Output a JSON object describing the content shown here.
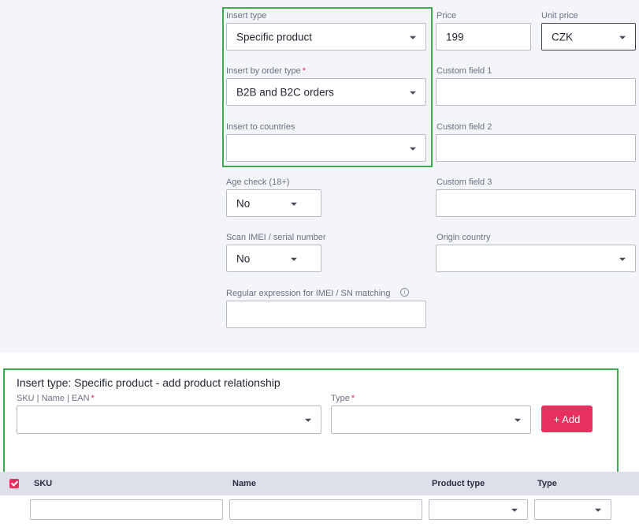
{
  "settings": {
    "insert_type": {
      "label": "Insert type",
      "value": "Specific product"
    },
    "price": {
      "label": "Price",
      "value": "199"
    },
    "unit_price": {
      "label": "Unit price",
      "value": "CZK"
    },
    "insert_by_order_type": {
      "label": "Insert by order type",
      "required_mark": "*",
      "value": "B2B and B2C orders"
    },
    "custom_field_1": {
      "label": "Custom field 1",
      "value": ""
    },
    "insert_to_countries": {
      "label": "Insert to countries",
      "value": ""
    },
    "custom_field_2": {
      "label": "Custom field 2",
      "value": ""
    },
    "age_check": {
      "label": "Age check (18+)",
      "value": "No"
    },
    "custom_field_3": {
      "label": "Custom field 3",
      "value": ""
    },
    "scan_imei": {
      "label": "Scan IMEI / serial number",
      "value": "No"
    },
    "origin_country": {
      "label": "Origin country",
      "value": ""
    },
    "regex": {
      "label": "Regular expression for IMEI / SN matching",
      "value": "",
      "info_icon": "info-icon"
    }
  },
  "relationship": {
    "title": "Insert type: Specific product - add product relationship",
    "sku_label": "SKU | Name | EAN",
    "sku_required_mark": "*",
    "sku_value": "",
    "type_label": "Type",
    "type_required_mark": "*",
    "type_value": "",
    "add_button": "+ Add"
  },
  "table": {
    "columns": [
      "SKU",
      "Name",
      "Product type",
      "Type"
    ],
    "select_all_checked": true
  },
  "colors": {
    "accent": "#e8305f",
    "highlight": "#3cad4e",
    "panel_bg": "#f4f5f9",
    "table_header_bg": "#dde0eb"
  }
}
